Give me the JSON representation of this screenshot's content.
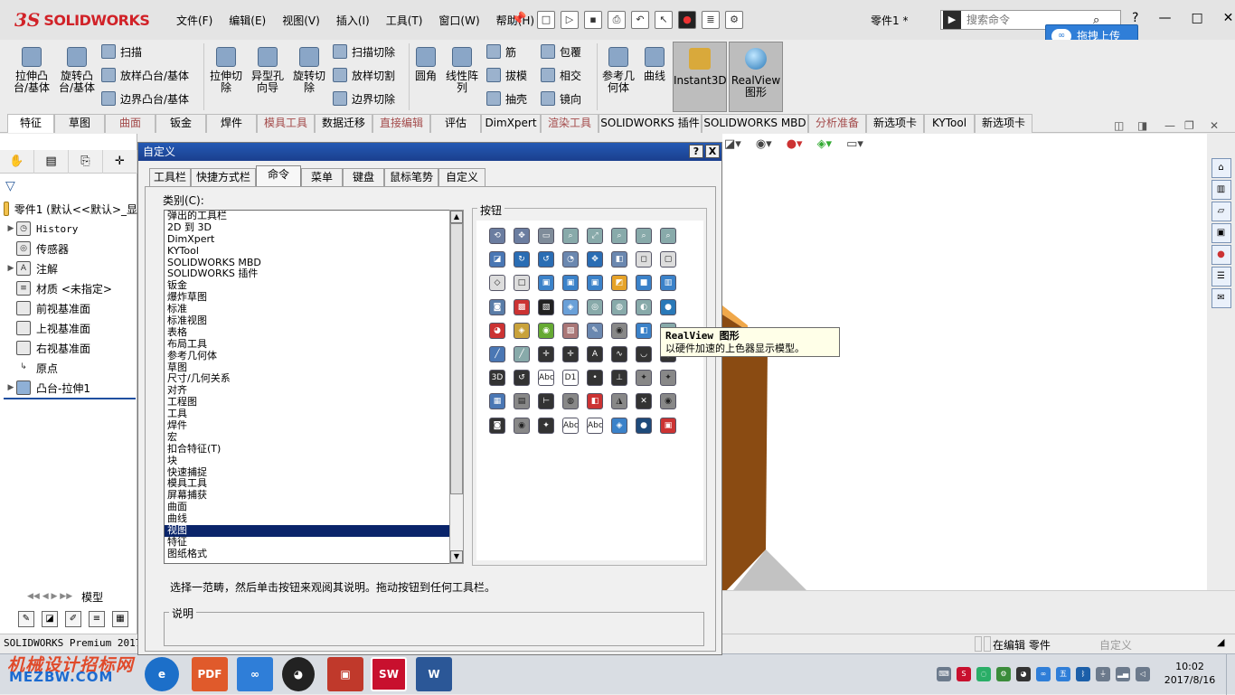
{
  "app": {
    "logo_ds": "3S",
    "logo_text": "SOLIDWORKS",
    "document_title": "零件1 *",
    "search_placeholder": "搜索命令",
    "upload_label": "拖拽上传"
  },
  "menu": [
    "文件(F)",
    "编辑(E)",
    "视图(V)",
    "插入(I)",
    "工具(T)",
    "窗口(W)",
    "帮助(H)"
  ],
  "ribbon": {
    "extrude_boss": "拉伸凸\n台/基体",
    "revolve_boss": "旋转凸\n台/基体",
    "sweep": "扫描",
    "loft_boss": "放样凸台/基体",
    "boundary_boss": "边界凸台/基体",
    "extrude_cut": "拉伸切\n除",
    "hole_wizard": "异型孔\n向导",
    "revolve_cut": "旋转切\n除",
    "swept_cut": "扫描切除",
    "lofted_cut": "放样切割",
    "boundary_cut": "边界切除",
    "fillet": "圆角",
    "linear_pattern": "线性阵\n列",
    "rib": "筋",
    "draft": "拔模",
    "shell": "抽壳",
    "wrap": "包覆",
    "intersect": "相交",
    "mirror": "镜向",
    "reference_geometry": "参考几\n何体",
    "curves": "曲线",
    "instant3d": "Instant3D",
    "realview": "RealView\n图形"
  },
  "ribbon_tabs": [
    "特征",
    "草图",
    "曲面",
    "钣金",
    "焊件",
    "模具工具",
    "数据迁移",
    "直接编辑",
    "评估",
    "DimXpert",
    "渲染工具",
    "SOLIDWORKS 插件",
    "SOLIDWORKS MBD",
    "分析准备",
    "新选项卡",
    "KYTool",
    "新选项卡"
  ],
  "tree": {
    "root": "零件1  (默认<<默认>_显",
    "items": [
      "History",
      "传感器",
      "注解",
      "材质 <未指定>",
      "前视基准面",
      "上视基准面",
      "右视基准面",
      "原点",
      "凸台-拉伸1"
    ]
  },
  "left_bottom": {
    "model_tab": "模型"
  },
  "dialog": {
    "title": "自定义",
    "help_btn": "?",
    "close_btn": "X",
    "tabs": [
      "工具栏",
      "快捷方式栏",
      "命令",
      "菜单",
      "键盘",
      "鼠标笔势",
      "自定义"
    ],
    "category_label": "类别(C):",
    "categories": [
      "弹出的工具栏",
      "2D 到 3D",
      "DimXpert",
      "KYTool",
      "SOLIDWORKS MBD",
      "SOLIDWORKS 插件",
      "钣金",
      "爆炸草图",
      "标准",
      "标准视图",
      "表格",
      "布局工具",
      "参考几何体",
      "草图",
      "尺寸/几何关系",
      "对齐",
      "工程图",
      "工具",
      "焊件",
      "宏",
      "扣合特征(T)",
      "块",
      "快速捕捉",
      "模具工具",
      "屏幕捕获",
      "曲面",
      "曲线",
      "视图",
      "特征",
      "图纸格式"
    ],
    "selected_category": "视图",
    "buttons_label": "按钮",
    "hint": "选择一范畴，然后单击按钮来观阅其说明。拖动按钮到任何工具栏。",
    "description_label": "说明"
  },
  "tooltip": {
    "title": "RealView 图形",
    "text": "以硬件加速的上色器显示模型。"
  },
  "status": {
    "left": "SOLIDWORKS Premium 2017 x",
    "editing": "在编辑 零件",
    "customize": "自定义"
  },
  "taskbar": {
    "watermark_top": "机械设计招标网",
    "watermark_bottom": "MEZBW.COM",
    "pdf_label": "PDF",
    "sw_label": "SW",
    "time": "10:02",
    "date": "2017/8/16"
  },
  "colors": {
    "accent_title": "#1b3f8e",
    "selection": "#0a246a",
    "brand_red": "#d12228",
    "box_side": "#8a4b12",
    "box_top": "#f0a84a"
  }
}
